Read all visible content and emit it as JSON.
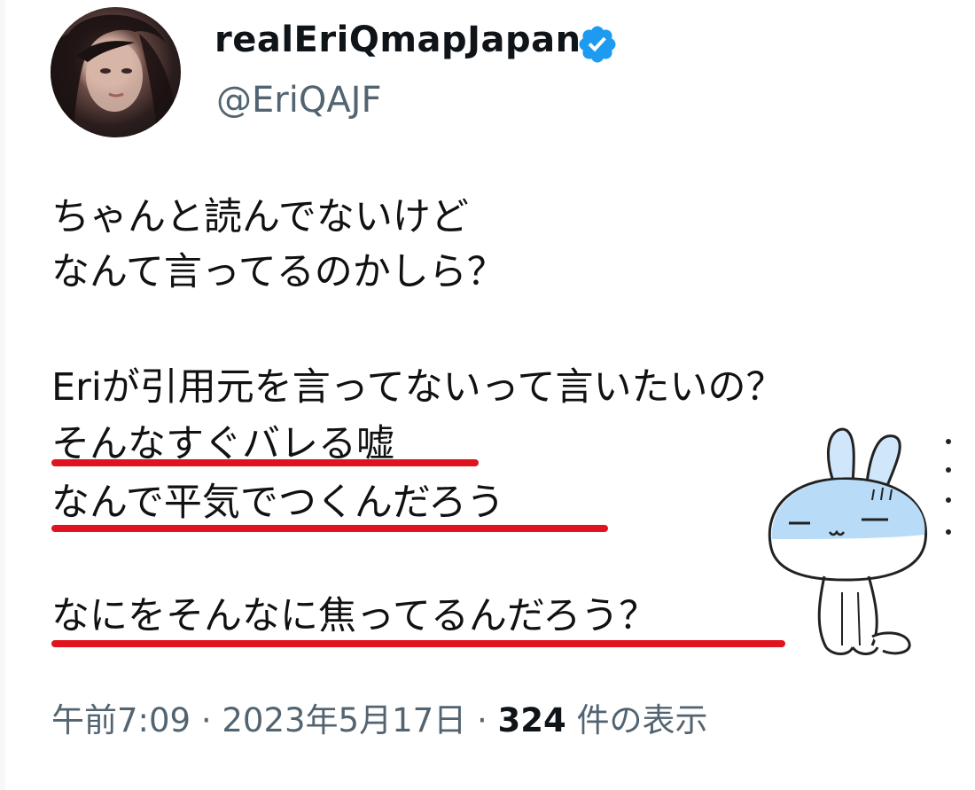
{
  "author": {
    "display_name": "realEriQmapJapan",
    "handle": "@EriQAJF",
    "verified_badge_icon": "verified-badge-icon"
  },
  "tweet": {
    "lines": [
      "ちゃんと読んでないけど",
      "なんて言ってるのかしら？",
      "Eriが引用元を言ってないって言いたいの？",
      "そんなすぐバレる嘘",
      "なんで平気でつくんだろう",
      "なにをそんなに焦ってるんだろう？"
    ],
    "underline_color": "#e0141f"
  },
  "meta": {
    "time": "午前7:09",
    "separator": "·",
    "date": "2023年5月17日",
    "views_count": "324",
    "views_label": "件の表示"
  },
  "colors": {
    "text": "#0f1419",
    "secondary": "#536471",
    "verified": "#1d9bf0"
  }
}
